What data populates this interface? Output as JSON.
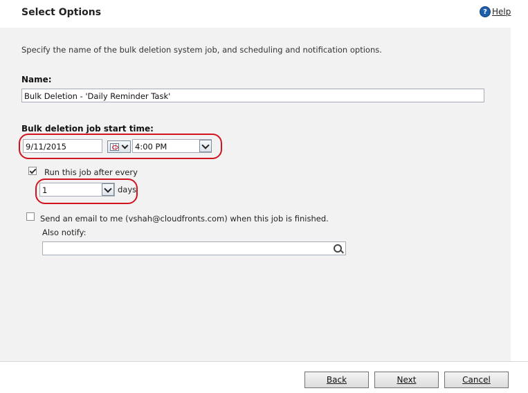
{
  "header": {
    "title": "Select Options",
    "help_label": "Help"
  },
  "description": "Specify the name of the bulk deletion system job, and scheduling and notification options.",
  "name_field": {
    "label": "Name:",
    "value": "Bulk Deletion - 'Daily Reminder Task'"
  },
  "start_time": {
    "label": "Bulk deletion job start time:",
    "date_value": "9/11/2015",
    "time_value": "4:00 PM"
  },
  "recurrence": {
    "checkbox_label": "Run this job after every",
    "checked": true,
    "interval_value": "1",
    "unit_label": "days"
  },
  "notification": {
    "checkbox_label": "Send an email to me (vshah@cloudfronts.com) when this job is finished.",
    "checked": false,
    "also_notify_label": "Also notify:",
    "also_notify_value": ""
  },
  "footer": {
    "back_label": "Back",
    "next_label": "Next",
    "cancel_label": "Cancel"
  },
  "colors": {
    "highlight_ring": "#d0141f",
    "panel_bg": "#f2f2f2",
    "help_icon": "#1e5fae"
  },
  "icons": [
    "help-icon",
    "calendar-icon",
    "chevron-down-icon",
    "lookup-icon",
    "checkbox-icon"
  ]
}
